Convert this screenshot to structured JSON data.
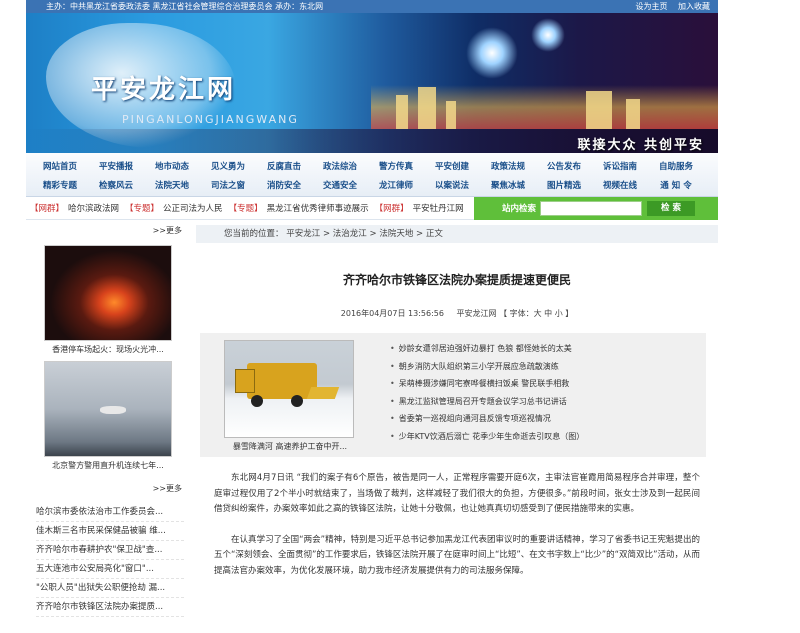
{
  "topbar": {
    "host": "主办：中共黑龙江省委政法委 黑龙江省社会管理综合治理委员会 承办：东北网",
    "links": [
      "设为主页",
      "加入收藏"
    ]
  },
  "banner": {
    "title": "平安龙江网",
    "pinyin": "PINGANLONGJIANGWANG",
    "slogan": "联接大众 共创平安"
  },
  "nav": {
    "row1": [
      "网站首页",
      "平安播报",
      "地市动态",
      "见义勇为",
      "反腐直击",
      "政法综治",
      "警方传真",
      "平安创建",
      "政策法规",
      "公告发布",
      "诉讼指南",
      "自助服务"
    ],
    "row2": [
      "精彩专题",
      "检察风云",
      "法院天地",
      "司法之窗",
      "消防安全",
      "交通安全",
      "龙江律师",
      "以案说法",
      "聚焦冰城",
      "图片精选",
      "视频在线",
      "通 知 令"
    ]
  },
  "ticker": {
    "items": [
      {
        "tag": "【网群】",
        "text": "哈尔滨政法网"
      },
      {
        "tag": "【专题】",
        "text": "公正司法为人民"
      },
      {
        "tag": "【专题】",
        "text": "黑龙江省优秀律师事迹展示"
      },
      {
        "tag": "【网群】",
        "text": "平安牡丹江网"
      },
      {
        "tag": "【专",
        "text": ""
      }
    ]
  },
  "search": {
    "label": "站内检索",
    "button": "检 索"
  },
  "sidebar": {
    "more1": ">>更多",
    "photos": [
      {
        "caption": "香港停车场起火：现场火光冲..."
      },
      {
        "caption": "北京警方警用直升机连续七年..."
      }
    ],
    "more2": ">>更多",
    "list": [
      "哈尔滨市委依法治市工作委员会...",
      "佳木斯三名市民采保健品被骗 维...",
      "齐齐哈尔市春耕护农\"保卫战\"查...",
      "五大连池市公安局亮化\"窗口\"...",
      "\"公职人员\"出狱失公职便抢劫 漏...",
      "齐齐哈尔市铁锋区法院办案提质..."
    ]
  },
  "breadcrumb": {
    "prefix": "您当前的位置：",
    "items": [
      "平安龙江",
      "法治龙江",
      "法院天地",
      "正文"
    ],
    "sep": " > "
  },
  "article": {
    "title": "齐齐哈尔市铁锋区法院办案提质提速更便民",
    "date": "2016年04月07日 13:56:56",
    "source": "平安龙江网",
    "fontsize": "【 字体：大 中 小 】",
    "paragraphs": [
      "东北网4月7日讯 “我们的案子有6个原告，被告是同一人，正常程序需要开庭6次，主审法官崔霞用简易程序合并审理，整个庭审过程仅用了2个半小时就结束了，当场做了裁判，这样减轻了我们很大的负担，方便很多。”前段时间，张女士涉及到一起民间借贷纠纷案件，办案效率如此之高的铁锋区法院，让她十分敬佩，也让她真真切切感受到了便民措施带来的实惠。",
      "在认真学习了全国“两会”精神，特别是习近平总书记参加黑龙江代表团审议时的重要讲话精神，学习了省委书记王宪魁提出的五个“深刻领会、全面贯彻”的工作要求后，铁锋区法院开展了在庭审时间上“比短”、在文书字数上“比少”的“双简双比”活动，从而提高法官办案效率，为优化发展环境，助力我市经济发展提供有力的司法服务保障。"
    ]
  },
  "related": {
    "photo_caption": "暴雪降满河 高速养护工奋中开...",
    "items": [
      "妙龄女遭邻居迫强奸边暴打 色狼 都怪她长的太美",
      "朝乡消防大队组织第三小学开展应急疏散演练",
      "呆萌棒摄涉嫌同宅寮哗餐横扫饭桌 警民联手相救",
      "黑龙江监狱管理局召开专题会议学习总书记讲话",
      "省委第一巡视组向通河县反馈专项巡视情况",
      "少年KTV饮酒后溺亡 花季少年生命逝去引叹息（图）"
    ]
  }
}
